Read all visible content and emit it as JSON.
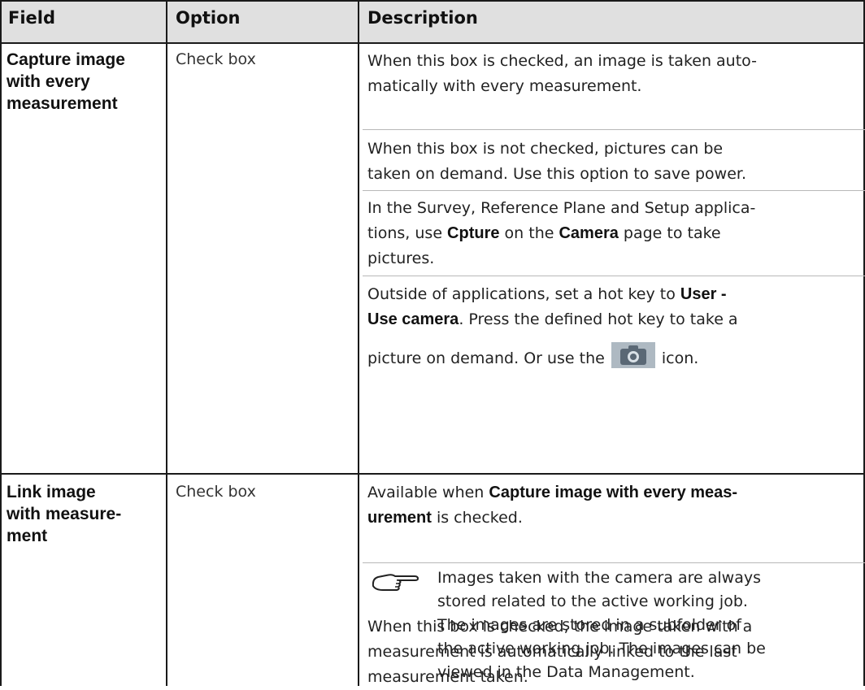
{
  "header": {
    "field": "Field",
    "option": "Option",
    "description": "Description"
  },
  "row1": {
    "field_lines": [
      "Capture image",
      "with every",
      "measurement"
    ],
    "option": "Check box",
    "p1": {
      "text": "When this box is checked, an image is taken automatically with every measurement.",
      "l1": "When this box is checked, an image is taken auto-",
      "l2": "matically with every measurement."
    },
    "p2": {
      "l1": "When this box is not checked, pictures can be",
      "l2": "taken on demand. Use this option to save power."
    },
    "p3": {
      "l1": "In the Survey, Reference Plane and Setup applica-",
      "l2_a": "tions, use ",
      "l2_b1": "Cpture",
      "l2_c": " on the ",
      "l2_b2": "Camera",
      "l2_d": " page to take",
      "l3": "pictures."
    },
    "p4": {
      "l1_a": "Outside of applications, set a hot key to ",
      "l1_b": "User -",
      "l2_b": "Use camera",
      "l2_c": ". Press the defined hot key to take a",
      "l3_a": "picture on demand. Or use the",
      "l3_b": "icon."
    },
    "note": {
      "icon": "pointing-hand-icon",
      "lines": [
        "Images taken with the camera are always",
        "stored related to the active working job.",
        "The images are stored in a subfolder of",
        "the active working job. The images can be",
        "viewed in the Data Management."
      ]
    },
    "camera_icon": "camera-icon"
  },
  "row2": {
    "field_lines": [
      "Link image",
      "with measure-",
      "ment"
    ],
    "option": "Check box",
    "p1": {
      "l1_a": "Available when ",
      "l1_b": "Capture image with every meas-",
      "l2_b": "urement",
      "l2_c": " is checked."
    },
    "p2": {
      "l1": "When this box is checked, the image taken with a",
      "l2": "measurement is automatically linked to the last",
      "l3": "measurement taken."
    }
  },
  "colors": {
    "header_bg": "#e0e0e0",
    "rule": "#1a1a1a",
    "separator": "#b8b8b8",
    "camera_icon_bg": "#aeb9c2"
  }
}
